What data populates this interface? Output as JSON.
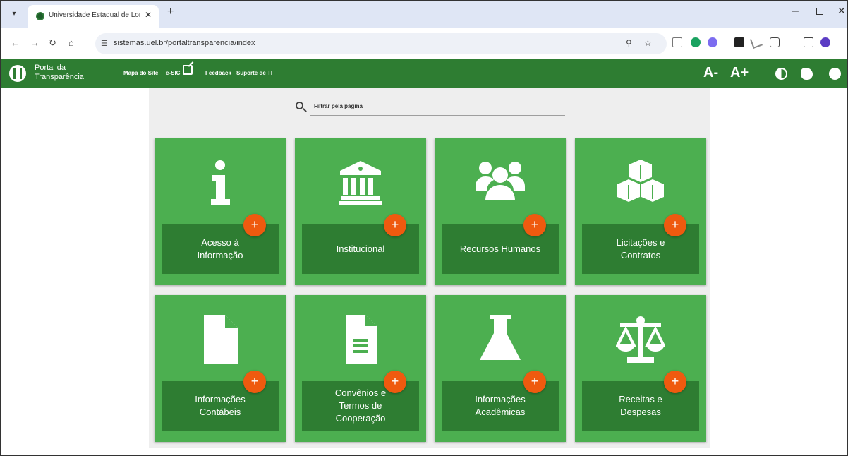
{
  "browser": {
    "tab_title": "Universidade Estadual de Londri",
    "tab_close": "✕",
    "new_tab": "+",
    "url": "sistemas.uel.br/portaltransparencia/index"
  },
  "header": {
    "brand_line1": "Portal da",
    "brand_line2": "Transparência",
    "menu": [
      "Mapa do Site",
      "e-SIC",
      "Feedback",
      "Suporte de TI"
    ],
    "font_decrease": "A-",
    "font_increase": "A+"
  },
  "search": {
    "placeholder": "Filtrar pela página"
  },
  "cards": [
    {
      "icon": "info-icon",
      "label_lines": [
        "Acesso à",
        "Informação"
      ]
    },
    {
      "icon": "institution-icon",
      "label_lines": [
        "Institucional"
      ]
    },
    {
      "icon": "users-icon",
      "label_lines": [
        "Recursos Humanos"
      ]
    },
    {
      "icon": "cubes-icon",
      "label_lines": [
        "Licitações e",
        "Contratos"
      ]
    },
    {
      "icon": "file-icon",
      "label_lines": [
        "Informações",
        "Contábeis"
      ]
    },
    {
      "icon": "document-icon",
      "label_lines": [
        "Convênios e",
        "Termos de",
        "Cooperação"
      ]
    },
    {
      "icon": "flask-icon",
      "label_lines": [
        "Informações",
        "Acadêmicas"
      ]
    },
    {
      "icon": "balance-scale-icon",
      "label_lines": [
        "Receitas e",
        "Despesas"
      ]
    }
  ],
  "plus_label": "+",
  "colors": {
    "header_green": "#2e7d32",
    "card_green": "#4caf50",
    "label_green": "#2e7d32",
    "plus_orange": "#ef5a0f"
  }
}
